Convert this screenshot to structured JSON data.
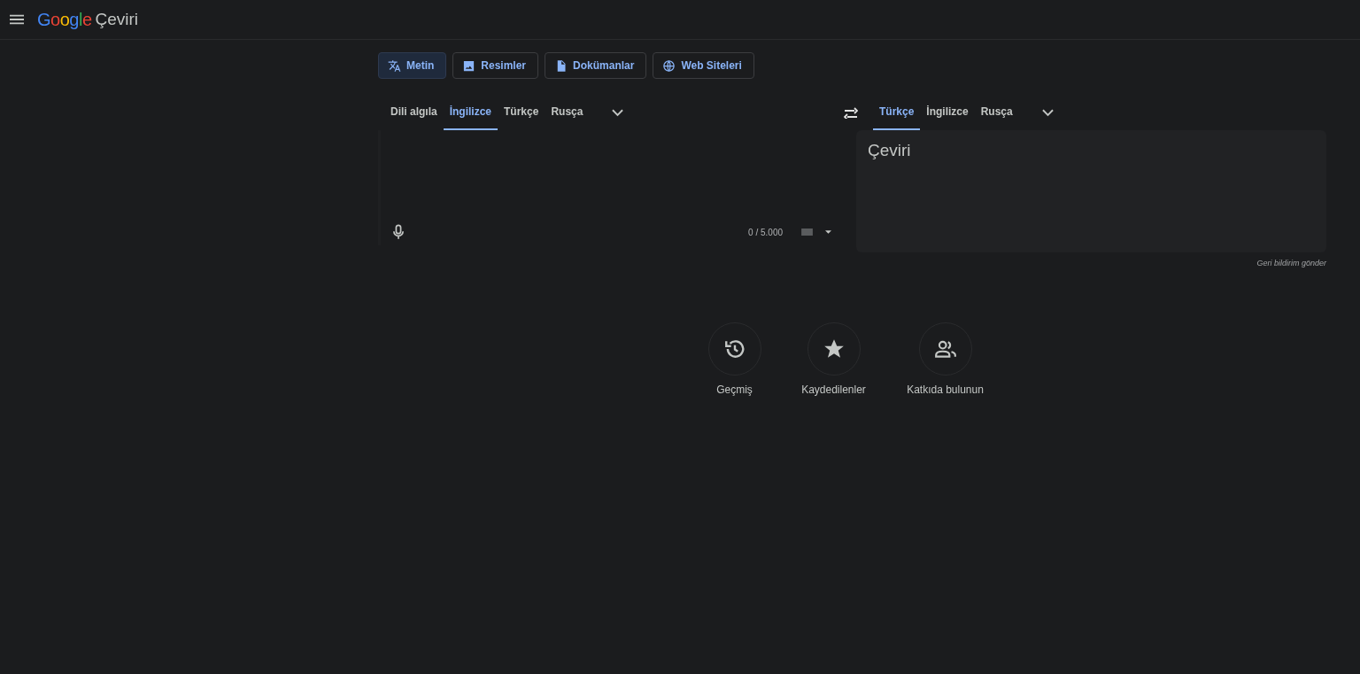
{
  "header": {
    "logo": "Google",
    "title": "Çeviri"
  },
  "modes": [
    {
      "kind": "text",
      "label": "Metin",
      "selected": true
    },
    {
      "kind": "image",
      "label": "Resimler",
      "selected": false
    },
    {
      "kind": "document",
      "label": "Dokümanlar",
      "selected": false
    },
    {
      "kind": "website",
      "label": "Web Siteleri",
      "selected": false
    }
  ],
  "source_languages": [
    {
      "label": "Dili algıla",
      "selected": false
    },
    {
      "label": "İngilizce",
      "selected": true
    },
    {
      "label": "Türkçe",
      "selected": false
    },
    {
      "label": "Rusça",
      "selected": false
    }
  ],
  "target_languages": [
    {
      "label": "Türkçe",
      "selected": true
    },
    {
      "label": "İngilizce",
      "selected": false
    },
    {
      "label": "Rusça",
      "selected": false
    }
  ],
  "source": {
    "char_count": "0 / 5.000"
  },
  "target": {
    "placeholder": "Çeviri"
  },
  "feedback": "Geri bildirim gönder",
  "actions": [
    {
      "kind": "history",
      "label": "Geçmiş"
    },
    {
      "kind": "saved",
      "label": "Kaydedilenler"
    },
    {
      "kind": "contribute",
      "label": "Katkıda bulunun"
    }
  ]
}
